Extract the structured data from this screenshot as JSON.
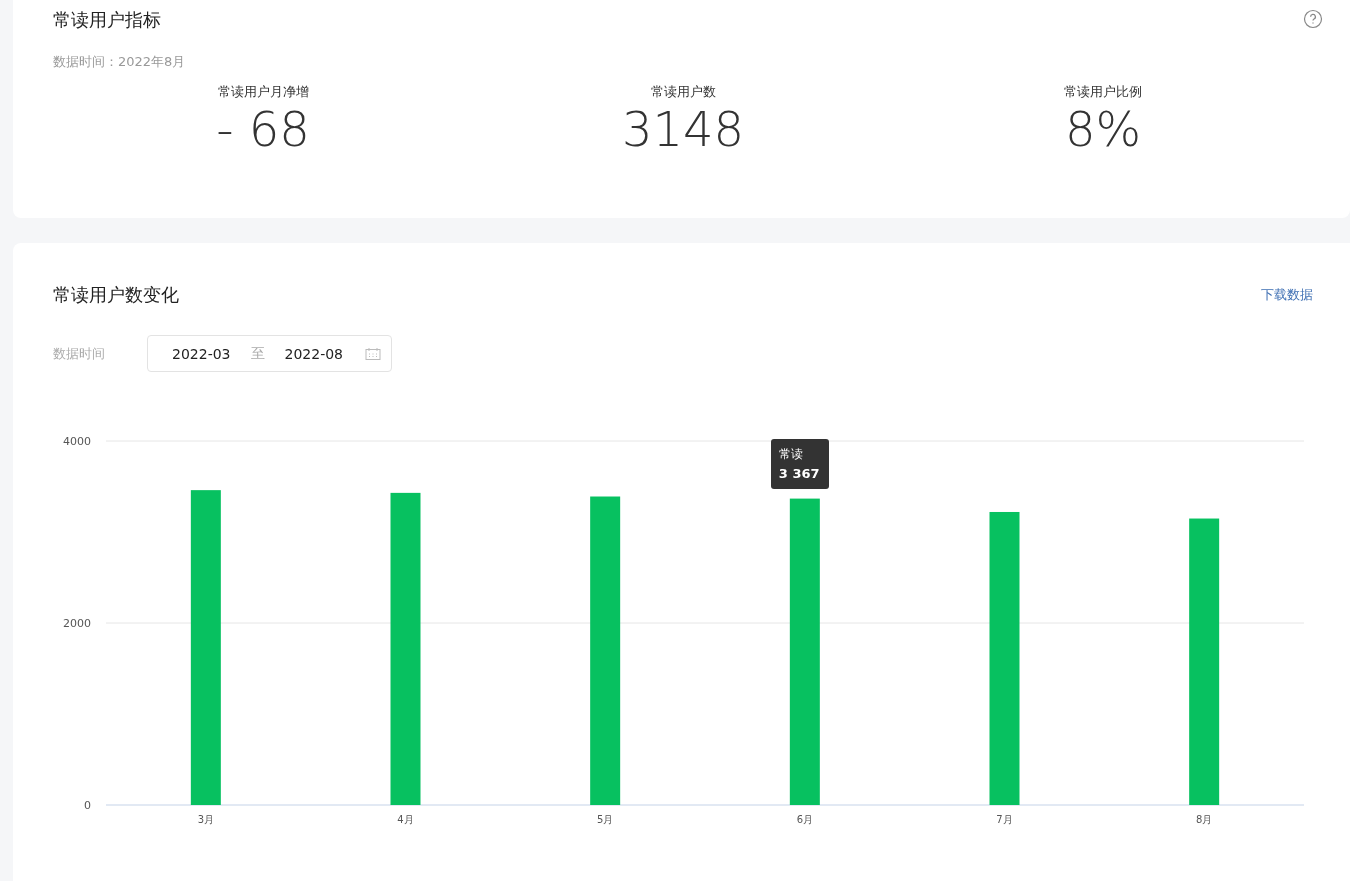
{
  "metrics_card": {
    "title": "常读用户指标",
    "data_time": "数据时间：2022年8月",
    "metrics": [
      {
        "label": "常读用户月净增",
        "value": "- 68"
      },
      {
        "label": "常读用户数",
        "value": "3148"
      },
      {
        "label": "常读用户比例",
        "value": "8%"
      }
    ]
  },
  "trend_card": {
    "title": "常读用户数变化",
    "download_link": "下载数据",
    "date_filter": {
      "label": "数据时间",
      "start": "2022-03",
      "separator": "至",
      "end": "2022-08"
    },
    "tooltip": {
      "value": "3 367"
    },
    "chart_data": {
      "type": "bar",
      "categories": [
        "3月",
        "4月",
        "5月",
        "6月",
        "7月",
        "8月"
      ],
      "series": [
        {
          "name": "常读",
          "color": "#07c160",
          "values": [
            3460,
            3430,
            3390,
            3367,
            3220,
            3148
          ]
        }
      ],
      "ylim": [
        0,
        4000
      ],
      "yticks": [
        0,
        2000,
        4000
      ]
    }
  }
}
